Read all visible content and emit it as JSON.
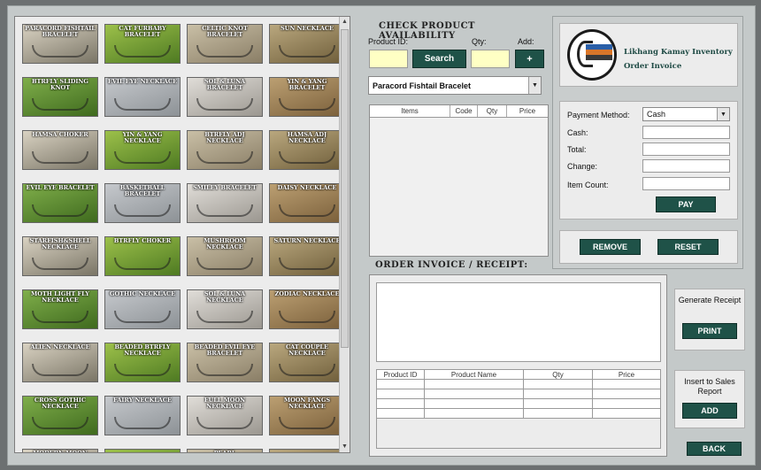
{
  "products": [
    "PARACORD FISHTAIL BRACELET",
    "CAT FURBABY BRACELET",
    "CELTIC KNOT BRACELET",
    "SUN NECKLACE",
    "BTRFLY SLIDING KNOT",
    "EVIL EYE NECKLACE",
    "SOL & LUNA BRACELET",
    "YIN & YANG BRACELET",
    "HAMSA CHOKER",
    "YIN & YANG NECKLACE",
    "BTRFLY ADJ NECKLACE",
    "HAMSA ADJ NECKLACE",
    "EVIL EYE BRACELET",
    "BASKETBALL BRACELET",
    "SMILEY BRACELET",
    "DAISY NECKLACE",
    "STARFISH&SHELL NECKLACE",
    "BTRFLY CHOKER",
    "MUSHROOM NECKLACE",
    "SATURN NECKLACE",
    "MOTH LIGHT FLY NECKLACE",
    "GOTHIC NECKLACE",
    "SOL & LUNA NECKLACE",
    "ZODIAC NECKLACE",
    "ALIEN NECKLACE",
    "BEADED BTRFLY NECKLACE",
    "BEADED EVIL EYE BRACELET",
    "CAT COUPLE NECKLACE",
    "CROSS GOTHIC NECKLACE",
    "FAIRY NECKLACE",
    "FULL MOON NECKLACE",
    "MOON FANGS NECKLACE",
    "MODERN MOON",
    "",
    "PEARL",
    ""
  ],
  "availability": {
    "heading": "CHECK PRODUCT AVAILABILITY",
    "product_id_label": "Product ID:",
    "qty_label": "Qty:",
    "add_label": "Add:",
    "search_button": "Search",
    "add_button": "+",
    "product_id_value": "",
    "qty_value": "",
    "selected_product": "Paracord Fishtail Bracelet",
    "table_columns": [
      "Items",
      "Code",
      "Qty",
      "Price"
    ]
  },
  "header": {
    "title_line1": "Likhang Kamay Inventory",
    "title_line2": "Order Invoice"
  },
  "payment": {
    "method_label": "Payment Method:",
    "method_value": "Cash",
    "cash_label": "Cash:",
    "total_label": "Total:",
    "change_label": "Change:",
    "item_count_label": "Item Count:",
    "pay_button": "PAY",
    "remove_button": "REMOVE",
    "reset_button": "RESET"
  },
  "invoice": {
    "heading": "ORDER INVOICE / RECEIPT:",
    "columns": [
      "Product ID",
      "Product Name",
      "Qty",
      "Price"
    ]
  },
  "side": {
    "generate_title": "Generate Receipt",
    "print_button": "PRINT",
    "insert_title": "Insert to Sales Report",
    "add_button": "ADD",
    "back_button": "BACK"
  },
  "colors": {
    "accent": "#1f5248",
    "field_yellow": "#ffffc4",
    "background": "#c4c9c9"
  }
}
